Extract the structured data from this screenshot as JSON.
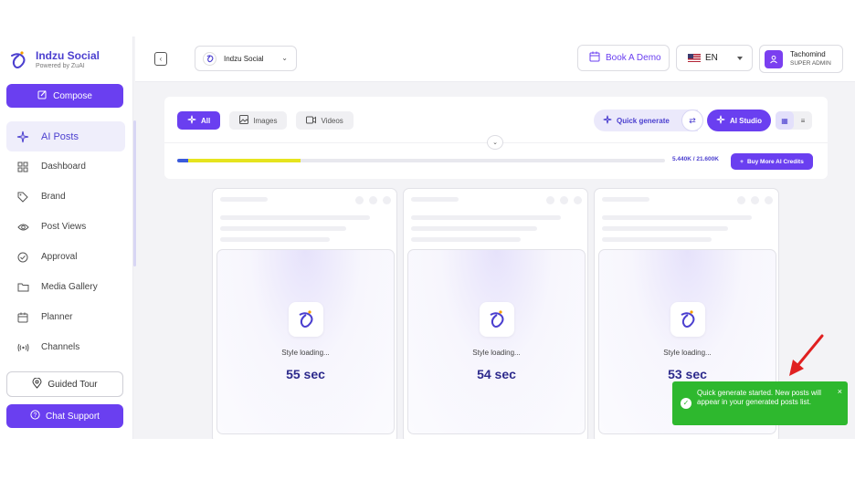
{
  "brand": {
    "name": "Indzu Social",
    "powered_by": "Powered by ZuAI"
  },
  "sidebar": {
    "compose_label": "Compose",
    "items": [
      {
        "label": "AI Posts",
        "icon": "sparkle-icon",
        "active": true
      },
      {
        "label": "Dashboard",
        "icon": "dashboard-icon"
      },
      {
        "label": "Brand",
        "icon": "tag-icon"
      },
      {
        "label": "Post Views",
        "icon": "eye-icon"
      },
      {
        "label": "Approval",
        "icon": "check-circle-icon"
      },
      {
        "label": "Media Gallery",
        "icon": "folder-icon"
      },
      {
        "label": "Planner",
        "icon": "calendar-icon"
      },
      {
        "label": "Channels",
        "icon": "broadcast-icon"
      }
    ],
    "guided_tour_label": "Guided Tour",
    "chat_support_label": "Chat Support"
  },
  "header": {
    "account_name": "Indzu Social",
    "book_demo_label": "Book A Demo",
    "language": "EN",
    "user_name": "Tachomind",
    "user_role": "SUPER ADMIN"
  },
  "toolbar": {
    "tabs": [
      {
        "label": "All",
        "active": true
      },
      {
        "label": "Images"
      },
      {
        "label": "Videos"
      }
    ],
    "quick_generate_label": "Quick generate",
    "ai_studio_label": "AI Studio",
    "credits_text": "5.440K / 21.600K",
    "credits_used_fraction": 0.252,
    "buy_credits_label": "Buy More AI Credits"
  },
  "cards": [
    {
      "status": "Style loading...",
      "countdown": "55 sec"
    },
    {
      "status": "Style loading...",
      "countdown": "54 sec"
    },
    {
      "status": "Style loading...",
      "countdown": "53 sec"
    }
  ],
  "toast": {
    "message": "Quick generate started. New posts will appear in your generated posts list.",
    "close": "×"
  },
  "colors": {
    "accent": "#6a3ff0",
    "brand_text": "#4b3fcf",
    "toast_green": "#2eb82e"
  }
}
